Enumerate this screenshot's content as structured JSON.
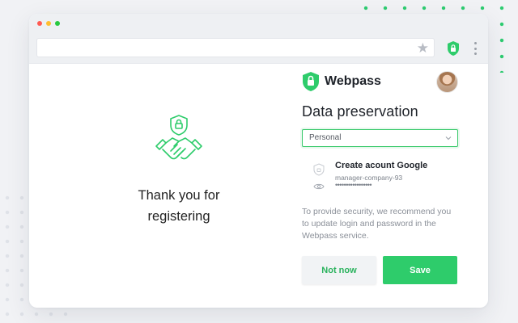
{
  "browser": {
    "url": "",
    "bookmark_icon": "star-icon",
    "extension_icon": "shield-lock-icon",
    "menu_icon": "kebab-menu-icon"
  },
  "left": {
    "illustration": "handshake-shield-icon",
    "thanks_line1": "Thank you for",
    "thanks_line2": "registering"
  },
  "popup": {
    "brand": "Webpass",
    "heading": "Data preservation",
    "vault_select": {
      "selected": "Personal"
    },
    "entry": {
      "title": "Create acount Google",
      "login": "manager-company-93",
      "password_mask": "•••••••••••••••••"
    },
    "notice": "To provide security, we recommend you to update login and password in the Webpass service.",
    "buttons": {
      "not_now": "Not now",
      "save": "Save"
    }
  },
  "colors": {
    "accent": "#2ecc6b",
    "accent_dark": "#2bb35e",
    "text": "#1e2229",
    "muted": "#8b9099"
  }
}
